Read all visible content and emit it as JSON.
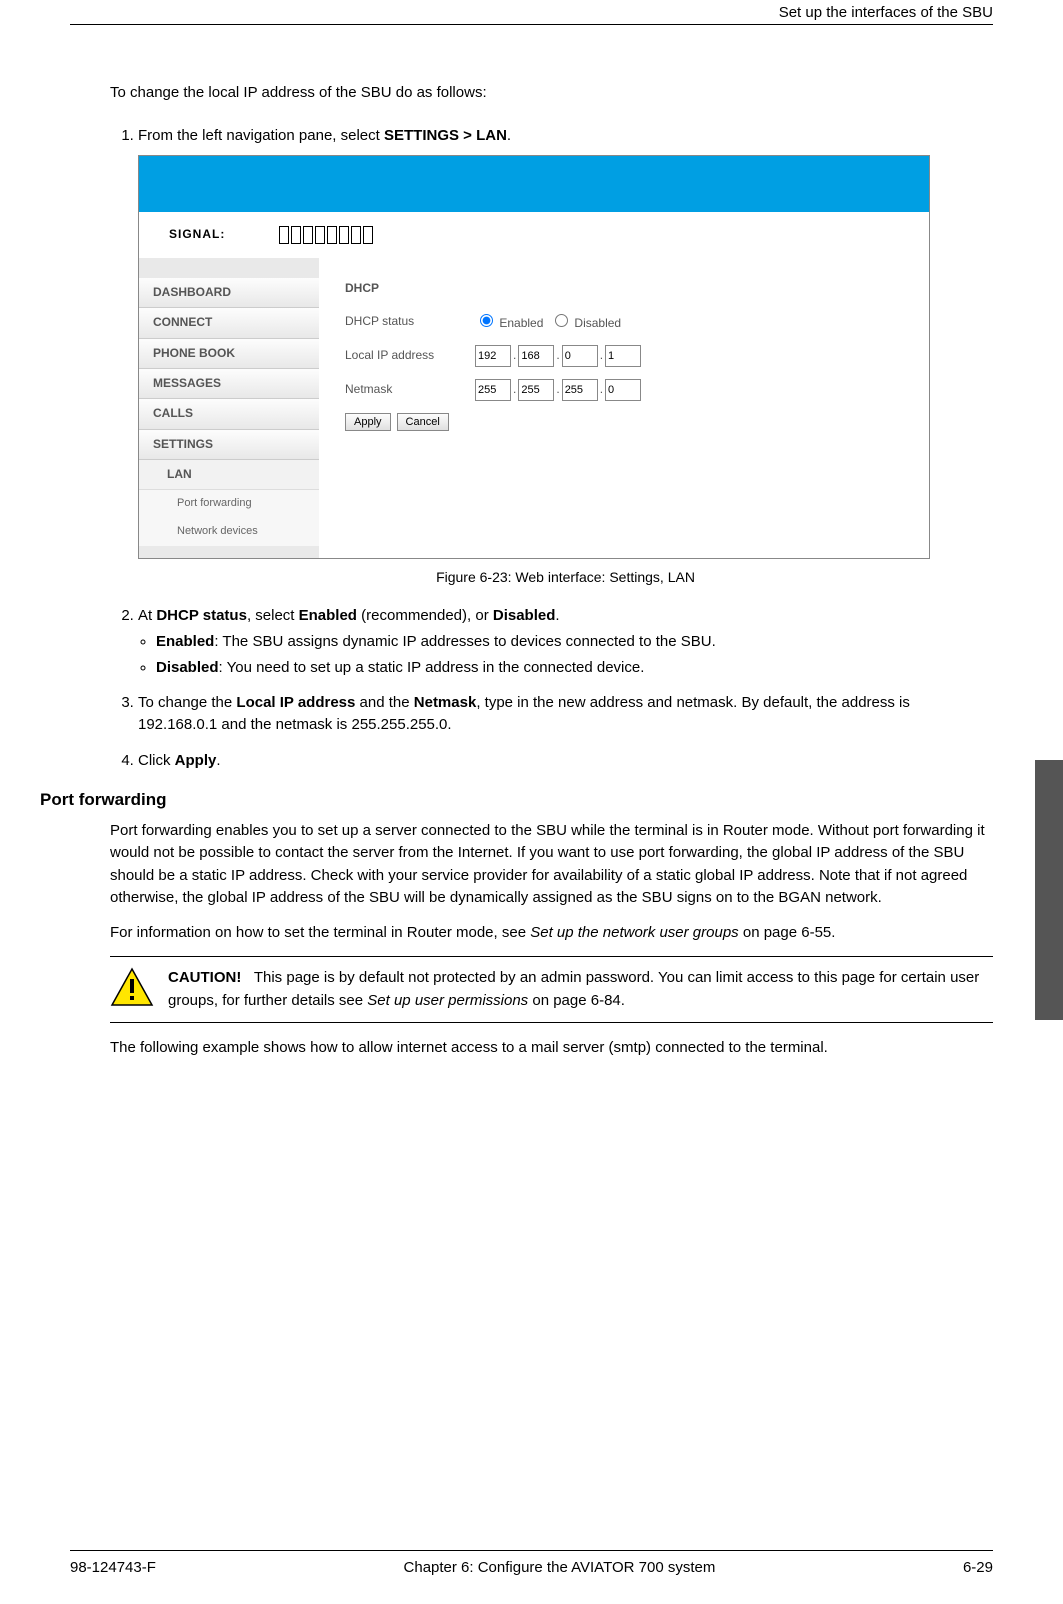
{
  "header": {
    "title": "Set up the interfaces of the SBU"
  },
  "intro": "To change the local IP address of the SBU do as follows:",
  "step1": {
    "prefix": "From the left navigation pane, select ",
    "bold": "SETTINGS > LAN",
    "suffix": "."
  },
  "ui": {
    "signal_label": "SIGNAL:",
    "nav": [
      "DASHBOARD",
      "CONNECT",
      "PHONE BOOK",
      "MESSAGES",
      "CALLS",
      "SETTINGS"
    ],
    "sub": "LAN",
    "subsub": [
      "Port forwarding",
      "Network devices"
    ],
    "panel": {
      "title": "DHCP",
      "dhcp_label": "DHCP status",
      "enabled": "Enabled",
      "disabled": "Disabled",
      "ip_label": "Local IP address",
      "ip": [
        "192",
        "168",
        "0",
        "1"
      ],
      "netmask_label": "Netmask",
      "netmask": [
        "255",
        "255",
        "255",
        "0"
      ],
      "apply": "Apply",
      "cancel": "Cancel"
    }
  },
  "figure_caption": "Figure 6-23: Web interface: Settings, LAN",
  "step2": {
    "prefix": "At ",
    "b1": "DHCP status",
    "mid": ", select ",
    "b2": "Enabled",
    "mid2": " (recommended), or ",
    "b3": "Disabled",
    "suffix": ".",
    "bullets": [
      {
        "b": "Enabled",
        "text": ": The SBU assigns dynamic IP addresses to devices connected to the SBU."
      },
      {
        "b": "Disabled",
        "text": ": You need to set up a static IP address in the connected device."
      }
    ]
  },
  "step3": {
    "prefix": "To change the ",
    "b1": "Local IP address",
    "mid": " and the ",
    "b2": "Netmask",
    "suffix": ", type in the new address and netmask. By default, the address is 192.168.0.1 and the netmask is 255.255.255.0."
  },
  "step4": {
    "prefix": "Click ",
    "b": "Apply",
    "suffix": "."
  },
  "section_heading": "Port forwarding",
  "pf_para1": "Port forwarding enables you to set up a server connected to the SBU while the terminal is in Router mode. Without port forwarding it would not be possible to contact the server from the Internet. If you want to use port forwarding, the global IP address of the SBU should be a static IP address. Check with your service provider for availability of a static global IP address. Note that if not agreed otherwise, the global IP address of the SBU will be dynamically assigned as the SBU signs on to the BGAN network.",
  "pf_para2_prefix": "For information on how to set the terminal in Router mode, see ",
  "pf_para2_em": "Set up the network user groups",
  "pf_para2_suffix": " on page 6-55.",
  "caution": {
    "label": "CAUTION!",
    "text_prefix": "This page is by default not protected by an admin password. You can limit access to this page for certain user groups, for further details see ",
    "text_em": "Set up user permissions",
    "text_suffix": " on page 6-84."
  },
  "pf_para3": "The following example shows how to allow internet access to a mail server (smtp) connected to the terminal.",
  "footer": {
    "left": "98-124743-F",
    "center": "Chapter 6:  Configure the AVIATOR 700 system",
    "right": "6-29"
  }
}
